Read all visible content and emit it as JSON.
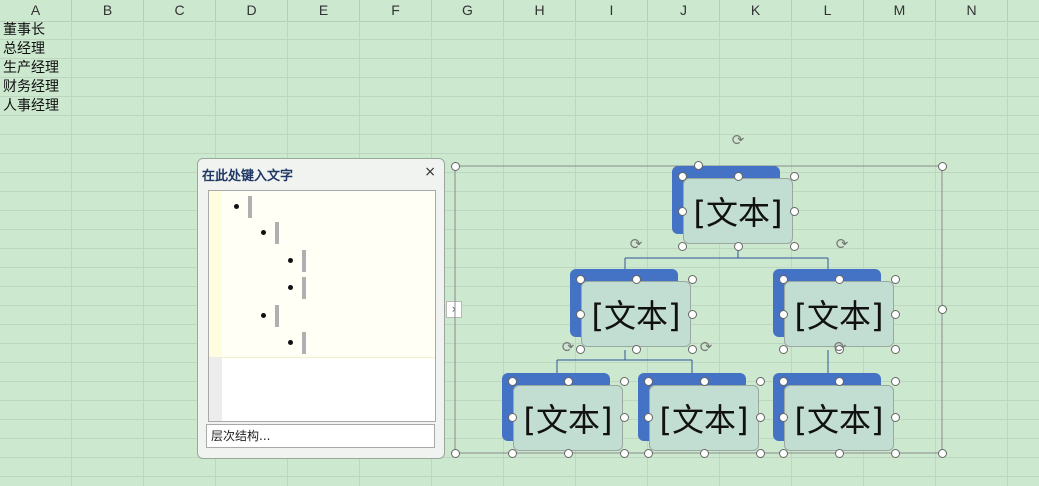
{
  "columns": [
    "A",
    "B",
    "C",
    "D",
    "E",
    "F",
    "G",
    "H",
    "I",
    "J",
    "K",
    "L",
    "M",
    "N"
  ],
  "cells": [
    "董事长",
    "总经理",
    "生产经理",
    "财务经理",
    "人事经理"
  ],
  "text_pane": {
    "title": "在此处键入文字",
    "close_symbol": "×",
    "footer": "层次结构...",
    "toggle_symbol": "›"
  },
  "smartart": {
    "node_label": "[文本]",
    "colors": {
      "back": "#4472c4",
      "front": "#c2ddd2",
      "connector": "#2f5597"
    }
  }
}
